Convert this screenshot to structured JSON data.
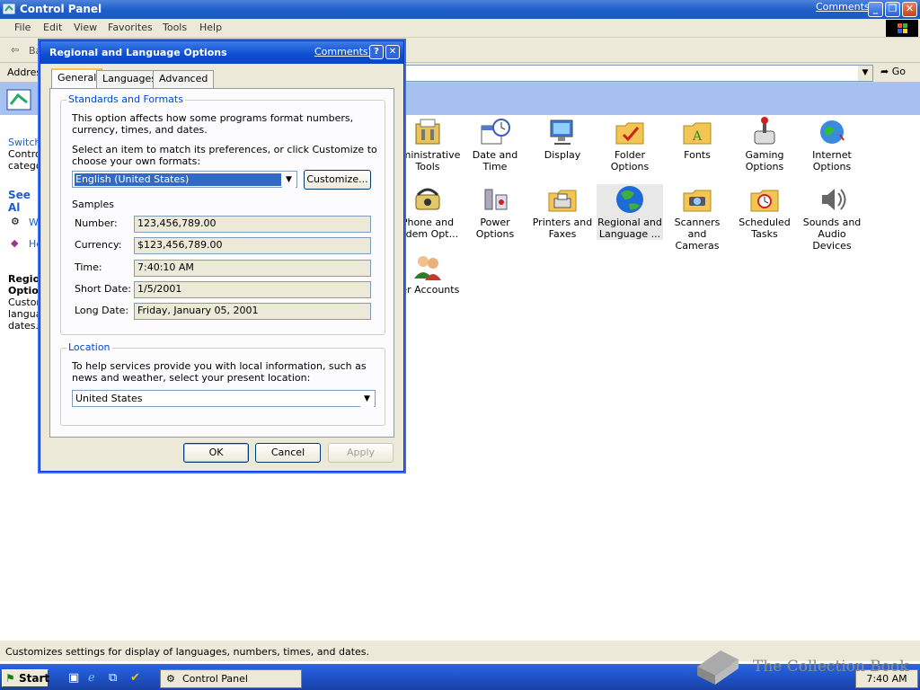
{
  "window": {
    "title": "Control Panel",
    "comments": "Comments?"
  },
  "menu": [
    "File",
    "Edit",
    "View",
    "Favorites",
    "Tools",
    "Help"
  ],
  "toolbar": {
    "back": "Ba"
  },
  "address": {
    "label": "Address",
    "go": "Go"
  },
  "left_panel": {
    "switch_lines": [
      "Switch",
      "Control",
      "categor"
    ],
    "see_also": "See Al",
    "links": [
      "Wi",
      "He"
    ],
    "details_title": [
      "Region",
      "Option"
    ],
    "details_text": [
      "Custom",
      "languag",
      "dates."
    ]
  },
  "items": [
    {
      "label": "dministrative\nTools",
      "icon": "administrative-tools-icon"
    },
    {
      "label": "Date and Time",
      "icon": "date-time-icon"
    },
    {
      "label": "Display",
      "icon": "display-icon"
    },
    {
      "label": "Folder Options",
      "icon": "folder-options-icon"
    },
    {
      "label": "Fonts",
      "icon": "fonts-icon"
    },
    {
      "label": "Gaming\nOptions",
      "icon": "gaming-options-icon"
    },
    {
      "label": "Internet\nOptions",
      "icon": "internet-options-icon"
    },
    {
      "label": "Phone and\nlodem Opt...",
      "icon": "phone-modem-icon"
    },
    {
      "label": "Power Options",
      "icon": "power-options-icon"
    },
    {
      "label": "Printers and\nFaxes",
      "icon": "printers-faxes-icon"
    },
    {
      "label": "Regional and\nLanguage ...",
      "icon": "regional-language-icon"
    },
    {
      "label": "Scanners and\nCameras",
      "icon": "scanners-cameras-icon"
    },
    {
      "label": "Scheduled\nTasks",
      "icon": "scheduled-tasks-icon"
    },
    {
      "label": "Sounds and\nAudio Devices",
      "icon": "sounds-audio-icon"
    },
    {
      "label": "ser Accounts",
      "icon": "user-accounts-icon"
    }
  ],
  "status_text": "Customizes settings for display of languages, numbers, times, and dates.",
  "taskbar": {
    "start": "Start",
    "task": "Control Panel",
    "clock": "7:40 AM"
  },
  "watermark": "The Collection Book",
  "dialog": {
    "title": "Regional and Language Options",
    "comments": "Comments?",
    "tabs": [
      "General",
      "Languages",
      "Advanced"
    ],
    "standards_legend": "Standards and Formats",
    "standards_desc": "This option affects how some programs format numbers, currency, times, and dates.",
    "select_desc": "Select an item to match its preferences, or click Customize to choose your own formats:",
    "format_value": "English (United States)",
    "customize": "Customize...",
    "samples_label": "Samples",
    "samples": [
      {
        "label": "Number:",
        "value": "123,456,789.00"
      },
      {
        "label": "Currency:",
        "value": "$123,456,789.00"
      },
      {
        "label": "Time:",
        "value": "7:40:10 AM"
      },
      {
        "label": "Short Date:",
        "value": "1/5/2001"
      },
      {
        "label": "Long Date:",
        "value": "Friday, January 05, 2001"
      }
    ],
    "location_legend": "Location",
    "location_desc": "To help services provide you with local information, such as news and weather, select your present location:",
    "location_value": "United States",
    "ok": "OK",
    "cancel": "Cancel",
    "apply": "Apply"
  }
}
